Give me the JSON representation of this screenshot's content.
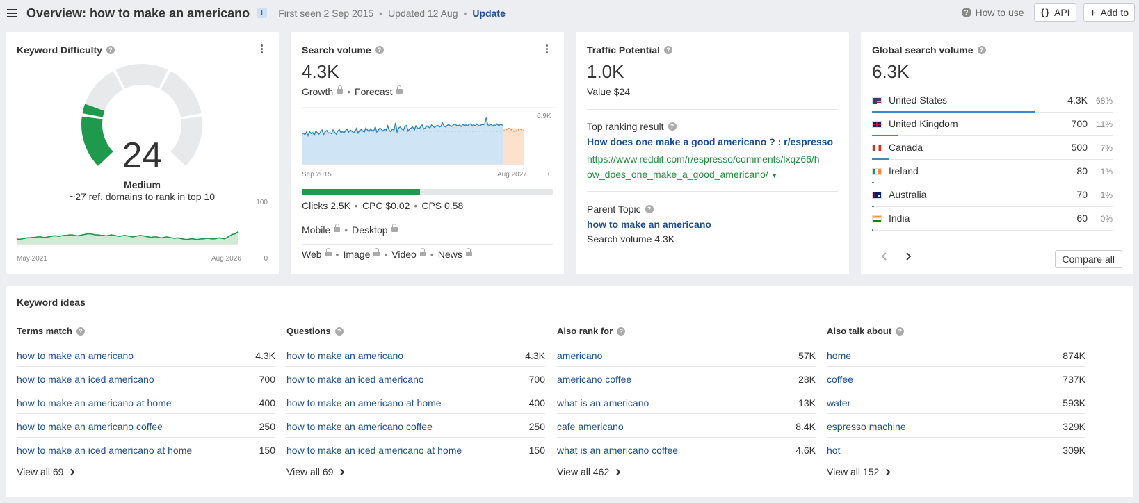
{
  "header": {
    "title": "Overview: how to make an americano",
    "lang_badge": "I",
    "first_seen": "First seen 2 Sep 2015",
    "updated": "Updated 12 Aug",
    "update_link": "Update",
    "how_to_use": "How to use",
    "api_label": "API",
    "add_to_label": "Add to"
  },
  "kd": {
    "title": "Keyword Difficulty",
    "value": "24",
    "level": "Medium",
    "description": "~27 ref. domains to rank in top 10",
    "chart_x_start": "May 2021",
    "chart_x_end": "Aug 2026",
    "chart_y_max": "100",
    "chart_y_min": "0",
    "gauge_fraction": 0.24,
    "accent": "#1f9a4c"
  },
  "sv": {
    "title": "Search volume",
    "value": "4.3K",
    "growth": "Growth",
    "forecast": "Forecast",
    "chart_y_max": "6.9K",
    "chart_y_min": "0",
    "chart_x_start": "Sep 2015",
    "chart_x_end": "Aug 2027",
    "clicks_share": 0.47,
    "clicks": "Clicks 2.5K",
    "cpc": "CPC $0.02",
    "cps": "CPS 0.58",
    "mobile": "Mobile",
    "desktop": "Desktop",
    "web": "Web",
    "image": "Image",
    "video": "Video",
    "news": "News"
  },
  "tp": {
    "title": "Traffic Potential",
    "value": "1.0K",
    "value_label": "Value $24",
    "top_result_label": "Top ranking result",
    "top_result_title": "How does one make a good americano ? : r/espresso",
    "top_result_url_1": "https://www.reddit.com/r/espresso/comments/lxqz66/h",
    "top_result_url_2": "ow_does_one_make_a_good_americano/",
    "parent_topic_label": "Parent Topic",
    "parent_topic": "how to make an americano",
    "parent_sv": "Search volume 4.3K"
  },
  "gsv": {
    "title": "Global search volume",
    "value": "6.3K",
    "countries": [
      {
        "name": "United States",
        "value": "4.3K",
        "pct": "68%",
        "share": 0.68,
        "flag": "us"
      },
      {
        "name": "United Kingdom",
        "value": "700",
        "pct": "11%",
        "share": 0.11,
        "flag": "gb"
      },
      {
        "name": "Canada",
        "value": "500",
        "pct": "7%",
        "share": 0.07,
        "flag": "ca"
      },
      {
        "name": "Ireland",
        "value": "80",
        "pct": "1%",
        "share": 0.01,
        "flag": "ie"
      },
      {
        "name": "Australia",
        "value": "70",
        "pct": "1%",
        "share": 0.01,
        "flag": "au"
      },
      {
        "name": "India",
        "value": "60",
        "pct": "0%",
        "share": 0.0,
        "flag": "in"
      }
    ],
    "compare_all": "Compare all"
  },
  "ideas": {
    "title": "Keyword ideas",
    "columns": [
      {
        "title": "Terms match",
        "rows": [
          {
            "kw": "how to make an americano",
            "v": "4.3K"
          },
          {
            "kw": "how to make an iced americano",
            "v": "700"
          },
          {
            "kw": "how to make an americano at home",
            "v": "400"
          },
          {
            "kw": "how to make an americano coffee",
            "v": "250"
          },
          {
            "kw": "how to make an iced americano at home",
            "v": "150"
          }
        ],
        "view_all": "View all 69"
      },
      {
        "title": "Questions",
        "rows": [
          {
            "kw": "how to make an americano",
            "v": "4.3K"
          },
          {
            "kw": "how to make an iced americano",
            "v": "700"
          },
          {
            "kw": "how to make an americano at home",
            "v": "400"
          },
          {
            "kw": "how to make an americano coffee",
            "v": "250"
          },
          {
            "kw": "how to make an iced americano at home",
            "v": "150"
          }
        ],
        "view_all": "View all 69"
      },
      {
        "title": "Also rank for",
        "rows": [
          {
            "kw": "americano",
            "v": "57K"
          },
          {
            "kw": "americano coffee",
            "v": "28K"
          },
          {
            "kw": "what is an americano",
            "v": "13K"
          },
          {
            "kw": "cafe americano",
            "v": "8.4K"
          },
          {
            "kw": "what is an americano coffee",
            "v": "4.6K"
          }
        ],
        "view_all": "View all 462"
      },
      {
        "title": "Also talk about",
        "rows": [
          {
            "kw": "home",
            "v": "874K"
          },
          {
            "kw": "coffee",
            "v": "737K"
          },
          {
            "kw": "water",
            "v": "593K"
          },
          {
            "kw": "espresso machine",
            "v": "329K"
          },
          {
            "kw": "hot",
            "v": "309K"
          }
        ],
        "view_all": "View all 152"
      }
    ]
  }
}
